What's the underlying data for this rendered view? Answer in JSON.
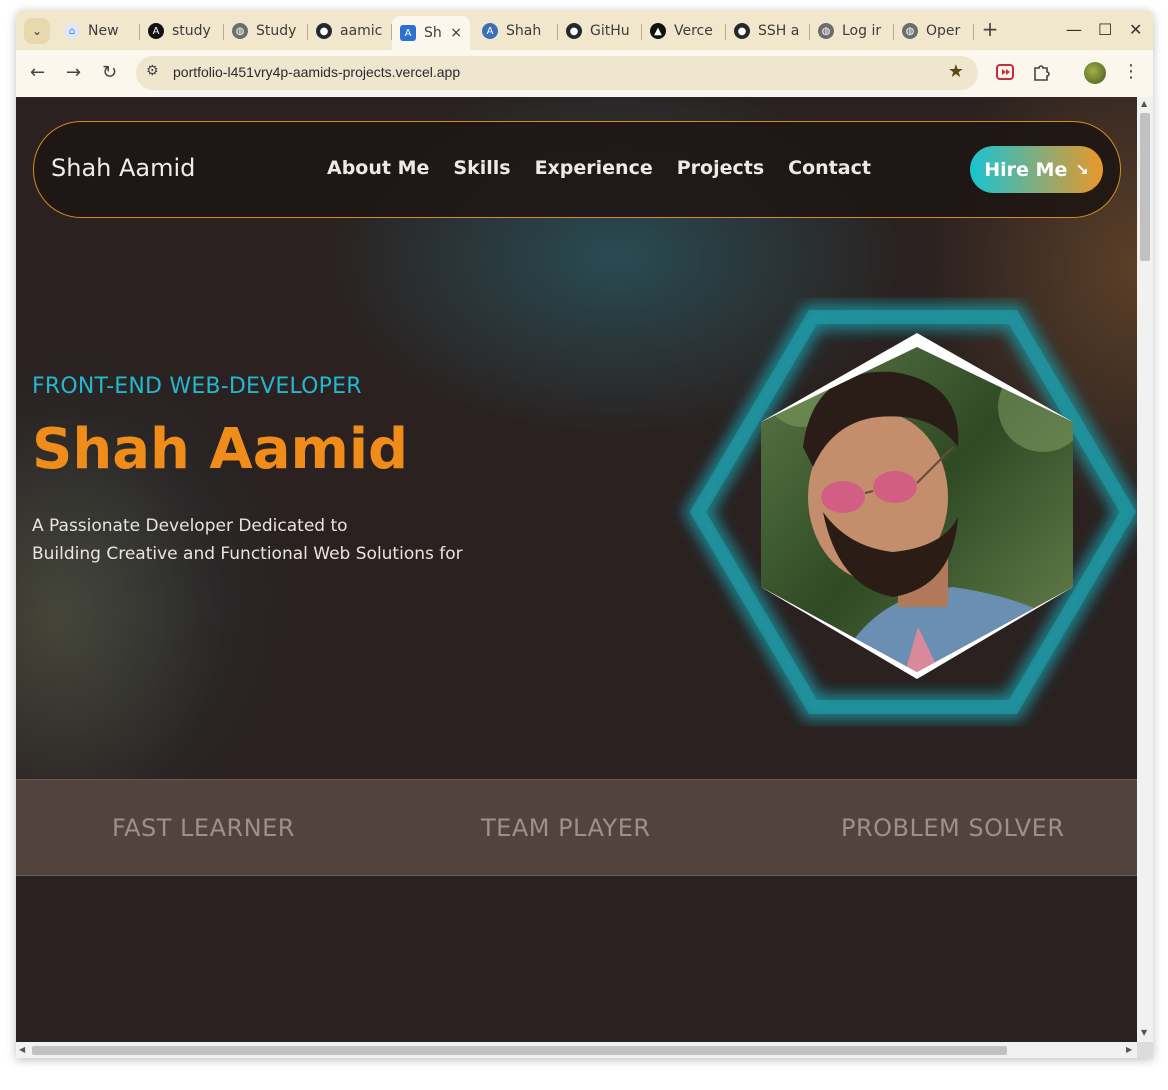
{
  "browser": {
    "tabs": [
      {
        "label": "New",
        "icon": "new-tab-icon",
        "color": "#4a7fd8"
      },
      {
        "label": "study",
        "icon": "circle-a-icon",
        "color": "#111111"
      },
      {
        "label": "Study",
        "icon": "globe-icon",
        "color": "#5f6368"
      },
      {
        "label": "aamic",
        "icon": "github-icon",
        "color": "#24292f"
      },
      {
        "label": "Sh",
        "icon": "a-square-icon",
        "color": "#2f6fcf"
      },
      {
        "label": "Shah",
        "icon": "a-circle-icon",
        "color": "#3b6fb8"
      },
      {
        "label": "GitHu",
        "icon": "github-icon",
        "color": "#24292f"
      },
      {
        "label": "Verce",
        "icon": "vercel-icon",
        "color": "#111111"
      },
      {
        "label": "SSH a",
        "icon": "github-icon",
        "color": "#24292f"
      },
      {
        "label": "Log ir",
        "icon": "globe-icon",
        "color": "#5f6368"
      },
      {
        "label": "Oper",
        "icon": "globe-icon",
        "color": "#5f6368"
      }
    ],
    "active_tab_close": "×",
    "new_tab": "+",
    "url": "portfolio-l451vry4p-aamids-projects.vercel.app"
  },
  "nav": {
    "brand": "Shah Aamid",
    "links": [
      "About Me",
      "Skills",
      "Experience",
      "Projects",
      "Contact"
    ],
    "cta_label": "Hire Me",
    "cta_icon": "↘"
  },
  "hero": {
    "role": "FRONT-END WEB-DEVELOPER",
    "name": "Shah Aamid",
    "description_line1": "A Passionate Developer Dedicated to",
    "description_line2": "Building Creative and Functional Web Solutions for"
  },
  "traits": [
    "FAST LEARNER",
    "TEAM PLAYER",
    "PROBLEM SOLVER"
  ],
  "colors": {
    "accent_orange": "#f08d1a",
    "accent_cyan": "#22b8cf",
    "background": "#2a2120",
    "trait_band": "#53433f"
  }
}
